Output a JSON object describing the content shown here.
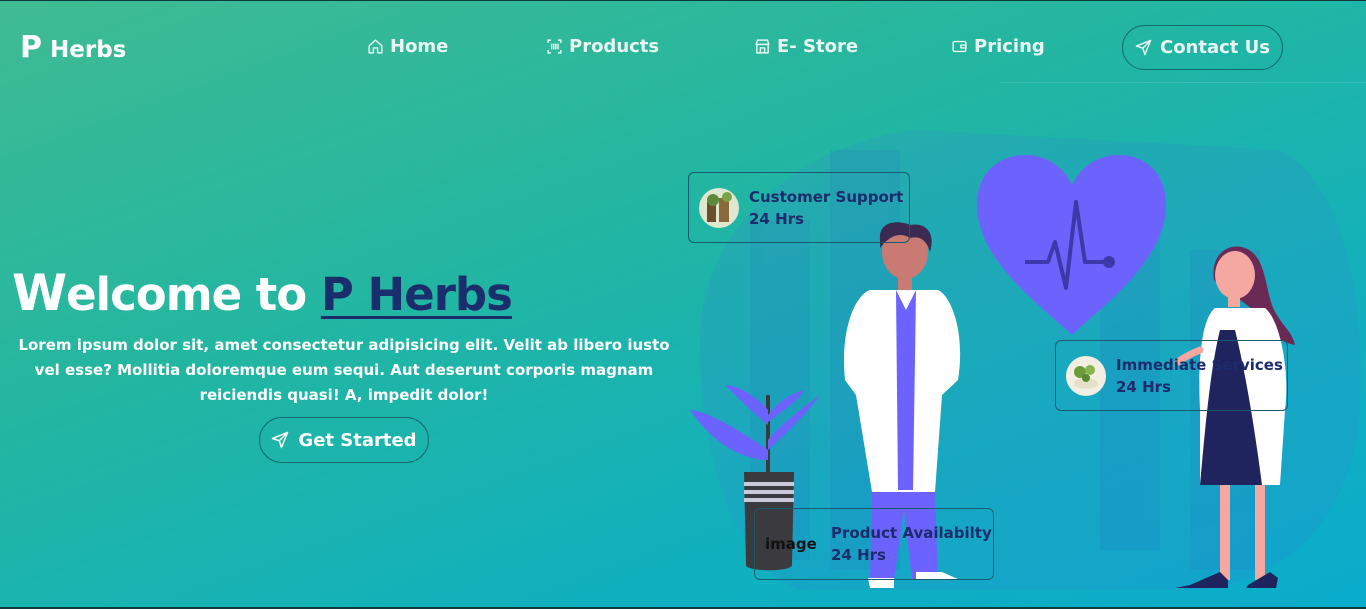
{
  "brand": {
    "letter": "P",
    "name": "Herbs"
  },
  "nav": {
    "home": "Home",
    "products": "Products",
    "estore": "E- Store",
    "pricing": "Pricing",
    "contact": "Contact Us"
  },
  "hero": {
    "title_w": "W",
    "title_rest": "elcome to ",
    "title_accent": "P Herbs",
    "description": "Lorem ipsum dolor sit, amet consectetur adipisicing elit. Velit ab libero iusto vel esse? Mollitia doloremque eum sequi. Aut deserunt corporis magnam reiciendis quasi! A, impedit dolor!",
    "cta": "Get Started"
  },
  "cards": [
    {
      "title": "Customer Support",
      "subtitle": "24 Hrs"
    },
    {
      "title": "Immediate Services",
      "subtitle": "24 Hrs"
    },
    {
      "title": "Product Availabilty",
      "subtitle": "24 Hrs",
      "image_alt": "image"
    }
  ],
  "colors": {
    "accent": "#1a2e6e",
    "heart": "#6c63ff",
    "gradient_start": "#3fbb92",
    "gradient_end": "#0aaccc"
  }
}
